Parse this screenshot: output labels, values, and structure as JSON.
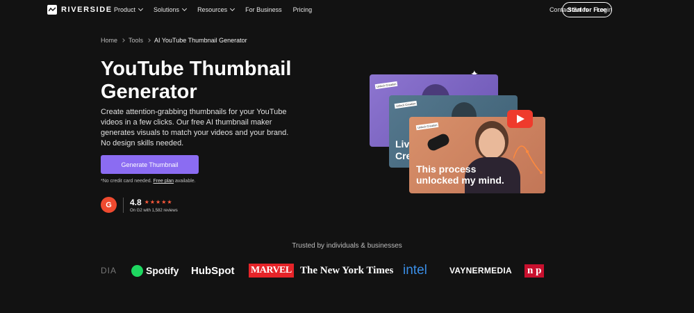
{
  "brand": {
    "name": "RIVERSIDE"
  },
  "nav": {
    "items": [
      {
        "label": "Product",
        "dropdown": true
      },
      {
        "label": "Solutions",
        "dropdown": true
      },
      {
        "label": "Resources",
        "dropdown": true
      },
      {
        "label": "For Business",
        "dropdown": false
      },
      {
        "label": "Pricing",
        "dropdown": false
      }
    ],
    "contact_label": "Contact Sales",
    "login_label": "Login",
    "cta_label": "Start for Free"
  },
  "breadcrumb": [
    "Home",
    "Tools",
    "AI YouTube Thumbnail Generator"
  ],
  "hero": {
    "title": "YouTube Thumbnail Generator",
    "description": "Create attention-grabbing thumbnails for your YouTube videos in a few clicks. Our free AI thumbnail maker generates visuals to match your videos and your brand. No design skills needed.",
    "button_label": "Generate Thumbnail",
    "fine_print_prefix": "*No credit card needed.",
    "fine_print_link": "Free plan",
    "fine_print_suffix": "available.",
    "rating": {
      "badge": "G",
      "score": "4.8",
      "stars": "★★★★★",
      "star_count": 5,
      "reviews": "On G2 with 1,582 reviews"
    }
  },
  "thumbnails": {
    "tag_text": "Unlock Creation",
    "card2_text": "Liv\nCre",
    "card3_line1": "This process",
    "card3_line2": "unlocked my mind."
  },
  "trusted": {
    "heading": "Trusted by individuals & businesses",
    "logos": [
      "DIA",
      "Spotify",
      "HubSpot",
      "MARVEL",
      "The New York Times",
      "intel",
      "VAYNERMEDIA",
      "np"
    ]
  },
  "colors": {
    "background": "#121212",
    "accent": "#8b6cf2",
    "g2": "#ef4a2f",
    "youtube": "#ef3b2c",
    "spotify": "#1ed760",
    "hubspot_o": "#ff7a59",
    "marvel": "#e62429",
    "intel": "#0071c5"
  },
  "icons": {
    "logo": "riverside-wave-icon",
    "chevron": "chevron-down-icon",
    "breadcrumb_sep": "chevron-right-icon",
    "play": "youtube-play-icon",
    "sparkle": "sparkle-icon"
  }
}
